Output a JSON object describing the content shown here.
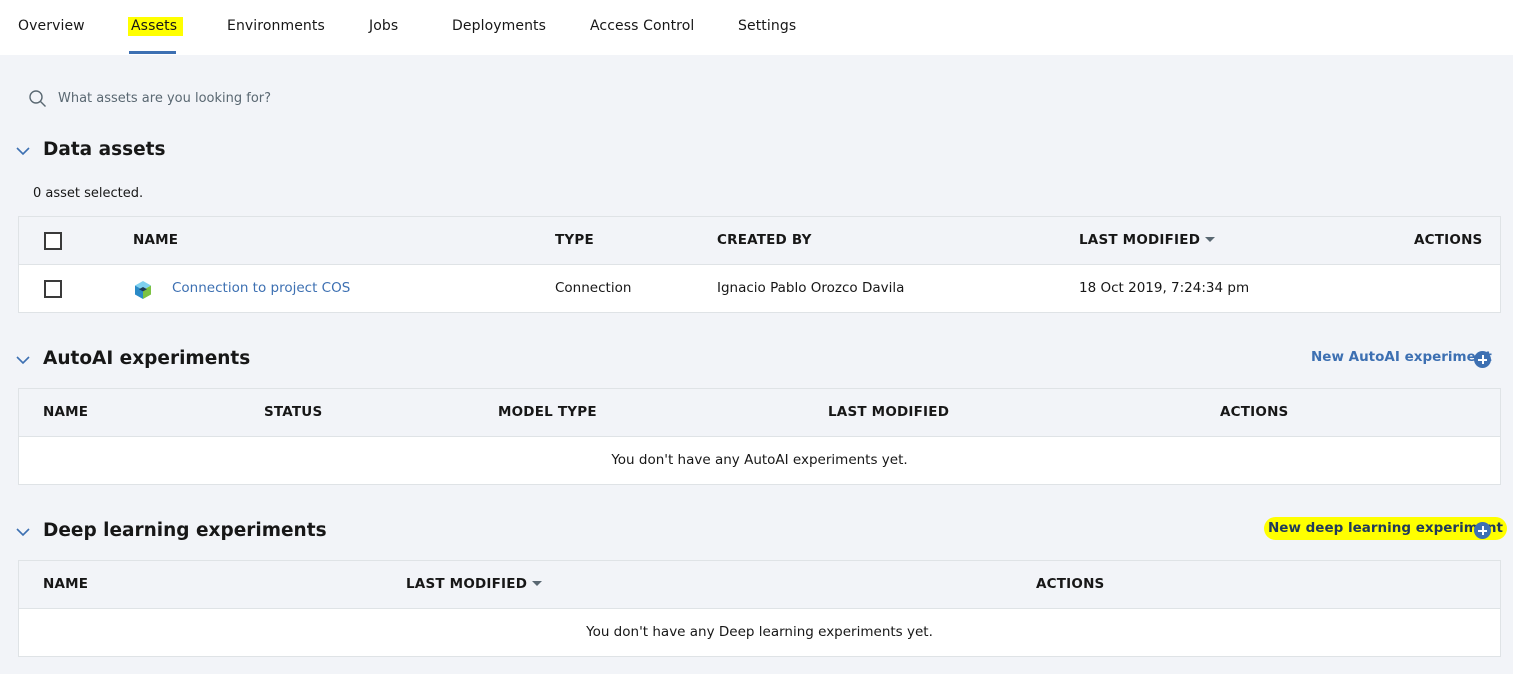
{
  "nav": {
    "tabs": [
      "Overview",
      "Assets",
      "Environments",
      "Jobs",
      "Deployments",
      "Access Control",
      "Settings"
    ],
    "active_tab": "Assets"
  },
  "search": {
    "placeholder": "What assets are you looking for?"
  },
  "data_assets": {
    "title": "Data assets",
    "selected_text": "0 asset selected.",
    "columns": [
      "NAME",
      "TYPE",
      "CREATED BY",
      "LAST MODIFIED",
      "ACTIONS"
    ],
    "rows": [
      {
        "name": "Connection to project COS",
        "type": "Connection",
        "created_by": "Ignacio Pablo Orozco Davila",
        "last_modified": "18 Oct 2019, 7:24:34 pm",
        "icon": "connection-cube-icon"
      }
    ]
  },
  "autoai": {
    "title": "AutoAI experiments",
    "new_label": "New AutoAI experiment",
    "columns": [
      "NAME",
      "STATUS",
      "MODEL TYPE",
      "LAST MODIFIED",
      "ACTIONS"
    ],
    "empty_text": "You don't have any AutoAI experiments yet."
  },
  "deep_learning": {
    "title": "Deep learning experiments",
    "new_label": "New deep learning experiment",
    "columns": [
      "NAME",
      "LAST MODIFIED",
      "ACTIONS"
    ],
    "empty_text": "You don't have any Deep learning experiments yet."
  },
  "colors": {
    "accent": "#3d70b2",
    "highlight": "#ffff00",
    "page_bg": "#f2f4f8"
  }
}
